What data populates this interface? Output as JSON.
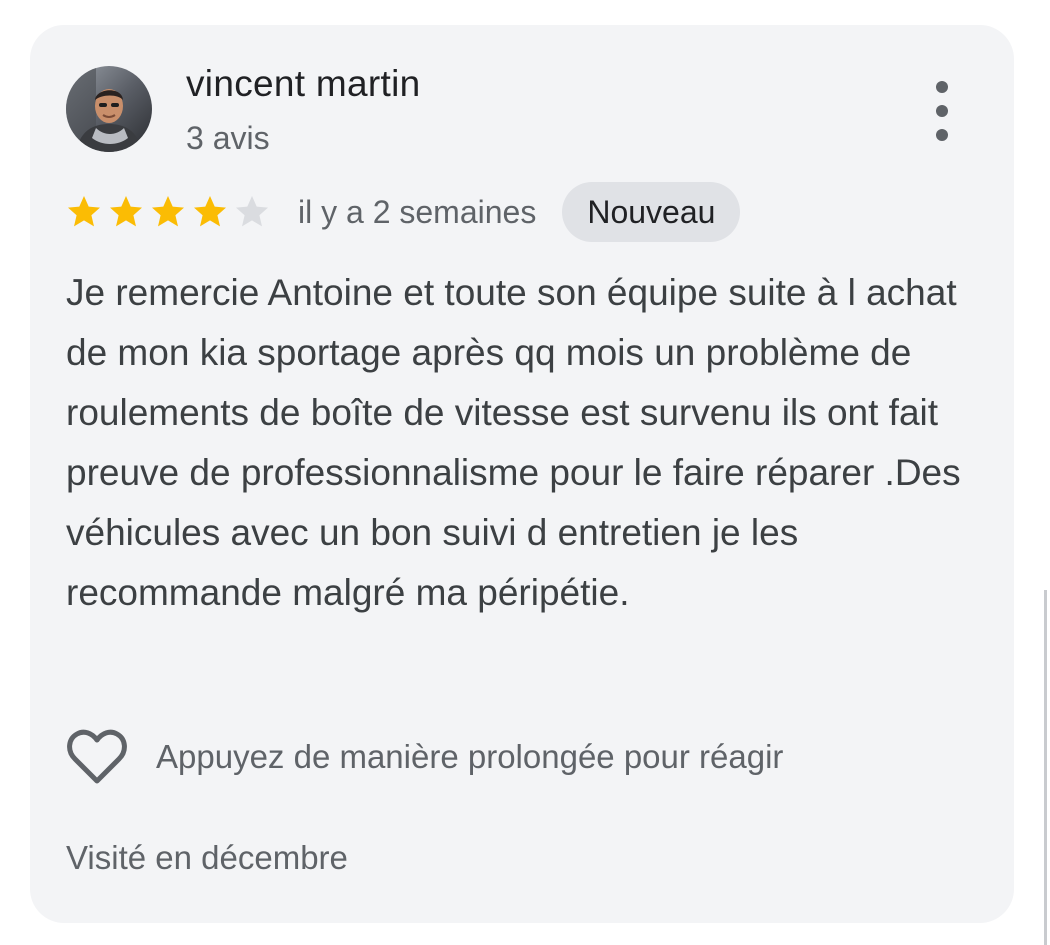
{
  "review": {
    "author": {
      "name": "vincent martin",
      "review_count": "3 avis",
      "avatar_icon": "person-photo"
    },
    "menu_icon": "more-vert-icon",
    "rating": 4,
    "rating_max": 5,
    "colors": {
      "star_filled": "#fbbc04",
      "star_empty": "#dadce0",
      "card_background": "#f3f4f6",
      "badge_background": "#e0e2e6"
    },
    "date": "il y a 2 semaines",
    "badge": "Nouveau",
    "text": "Je remercie Antoine et toute son équipe suite à l achat de mon kia sportage après qq mois un problème de roulements de boîte de vitesse est survenu ils ont fait preuve de professionnalisme pour le faire réparer .Des véhicules avec un bon suivi d entretien je les recommande malgré ma péripétie.",
    "react": {
      "icon": "heart-outline-icon",
      "label": "Appuyez de manière prolongée pour réagir"
    },
    "visited": "Visité en décembre"
  }
}
